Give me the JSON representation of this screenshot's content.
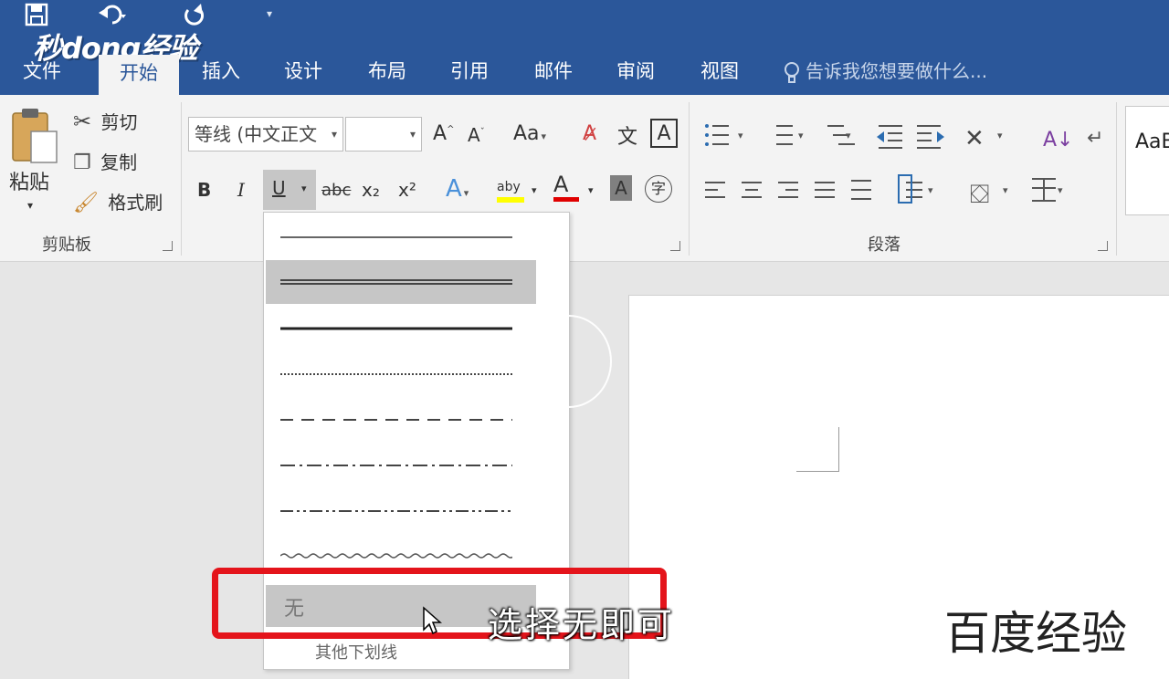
{
  "watermark": "秒dong经验",
  "tabs": [
    {
      "label": "文件"
    },
    {
      "label": "开始"
    },
    {
      "label": "插入"
    },
    {
      "label": "设计"
    },
    {
      "label": "布局"
    },
    {
      "label": "引用"
    },
    {
      "label": "邮件"
    },
    {
      "label": "审阅"
    },
    {
      "label": "视图"
    }
  ],
  "tell_me": "告诉我您想要做什么...",
  "clipboard": {
    "paste": "粘贴",
    "cut": "剪切",
    "copy": "复制",
    "format_painter": "格式刷",
    "group_label": "剪贴板"
  },
  "font": {
    "font_name": "等线 (中文正文",
    "font_size": "",
    "change_case": "Aa",
    "phonetic": "文",
    "bold": "B",
    "italic": "I",
    "underline": "U",
    "strike": "abc",
    "subscript": "x₂",
    "superscript": "x²",
    "highlight_label": "aby",
    "font_color_label": "A",
    "shading_label": "A",
    "enclose": "字"
  },
  "paragraph": {
    "group_label": "段落"
  },
  "styles": {
    "preview": "AaB"
  },
  "underline_menu": {
    "styles": [
      "single",
      "double",
      "thick",
      "dotted",
      "dashed",
      "dash-dot",
      "dash-dot-dot",
      "wave"
    ],
    "selected": "double",
    "none_label": "无",
    "more_label": "其他下划线"
  },
  "document": {
    "text": "百度经验"
  },
  "subtitle": "选择无即可",
  "colors": {
    "accent": "#2b579a",
    "highlight_box": "#e4141b"
  }
}
